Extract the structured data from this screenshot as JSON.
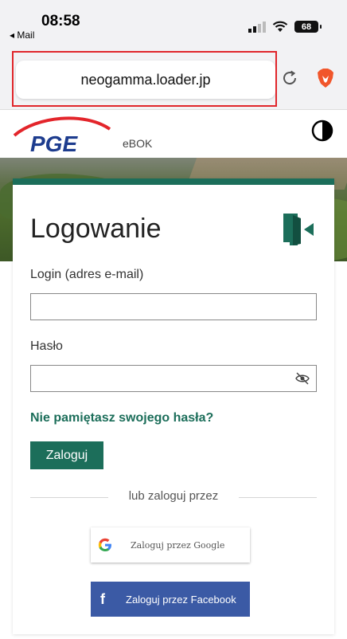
{
  "status_bar": {
    "time": "08:58",
    "back_app": "◂ Mail",
    "battery": "68"
  },
  "browser": {
    "url": "neogamma.loader.jp"
  },
  "site": {
    "logo_text": "PGE",
    "section": "eBOK"
  },
  "login": {
    "title": "Logowanie",
    "login_label": "Login (adres e-mail)",
    "login_value": "",
    "password_label": "Hasło",
    "password_value": "",
    "forgot_link": "Nie pamiętasz swojego hasła?",
    "submit_label": "Zaloguj",
    "divider_text": "lub zaloguj przez",
    "google_label": "Zaloguj przez Google",
    "facebook_label": "Zaloguj przez Facebook"
  },
  "colors": {
    "brand_green": "#1c6e5a",
    "facebook_blue": "#3b5aa5",
    "url_highlight": "#e0262b"
  }
}
